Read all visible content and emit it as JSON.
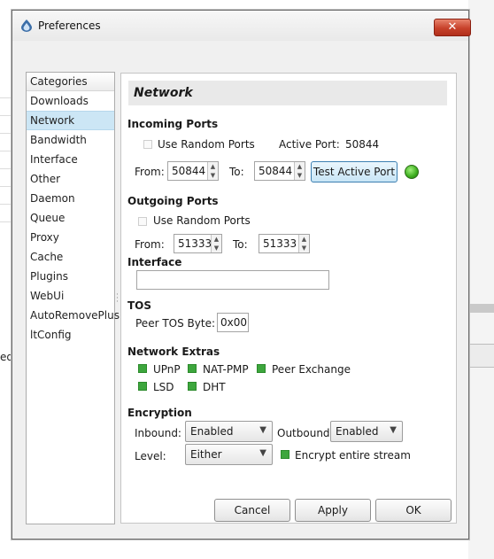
{
  "window": {
    "title": "Preferences",
    "close_glyph": "✕"
  },
  "background": {
    "left_text": "ed"
  },
  "categories": {
    "header": "Categories",
    "items": [
      "Downloads",
      "Network",
      "Bandwidth",
      "Interface",
      "Other",
      "Daemon",
      "Queue",
      "Proxy",
      "Cache",
      "Plugins",
      "WebUi",
      "AutoRemovePlus",
      "ltConfig"
    ],
    "selected": "Network"
  },
  "network": {
    "title": "Network",
    "incoming": {
      "heading": "Incoming Ports",
      "random_label": "Use Random Ports",
      "active_label": "Active Port:",
      "active_value": "50844",
      "from_label": "From:",
      "from_value": "50844",
      "to_label": "To:",
      "to_value": "50844",
      "test_button": "Test Active Port"
    },
    "outgoing": {
      "heading": "Outgoing Ports",
      "random_label": "Use Random Ports",
      "from_label": "From:",
      "from_value": "51333",
      "to_label": "To:",
      "to_value": "51333"
    },
    "interface": {
      "heading": "Interface",
      "value": ""
    },
    "tos": {
      "heading": "TOS",
      "label": "Peer TOS Byte:",
      "value": "0x00"
    },
    "extras": {
      "heading": "Network Extras",
      "upnp": "UPnP",
      "natpmp": "NAT-PMP",
      "pex": "Peer Exchange",
      "lsd": "LSD",
      "dht": "DHT"
    },
    "encryption": {
      "heading": "Encryption",
      "inbound_label": "Inbound:",
      "inbound_value": "Enabled",
      "outbound_label": "Outbound:",
      "outbound_value": "Enabled",
      "level_label": "Level:",
      "level_value": "Either",
      "encrypt_stream_label": "Encrypt entire stream"
    }
  },
  "buttons": {
    "cancel": "Cancel",
    "apply": "Apply",
    "ok": "OK"
  },
  "icons": {
    "app": "deluge-drop-icon",
    "dropdown": "▼",
    "spin_up": "▲",
    "spin_down": "▼"
  },
  "colors": {
    "selected_bg": "#cce6f5",
    "checked_green": "#3da63d",
    "close_red": "#c7412a"
  }
}
